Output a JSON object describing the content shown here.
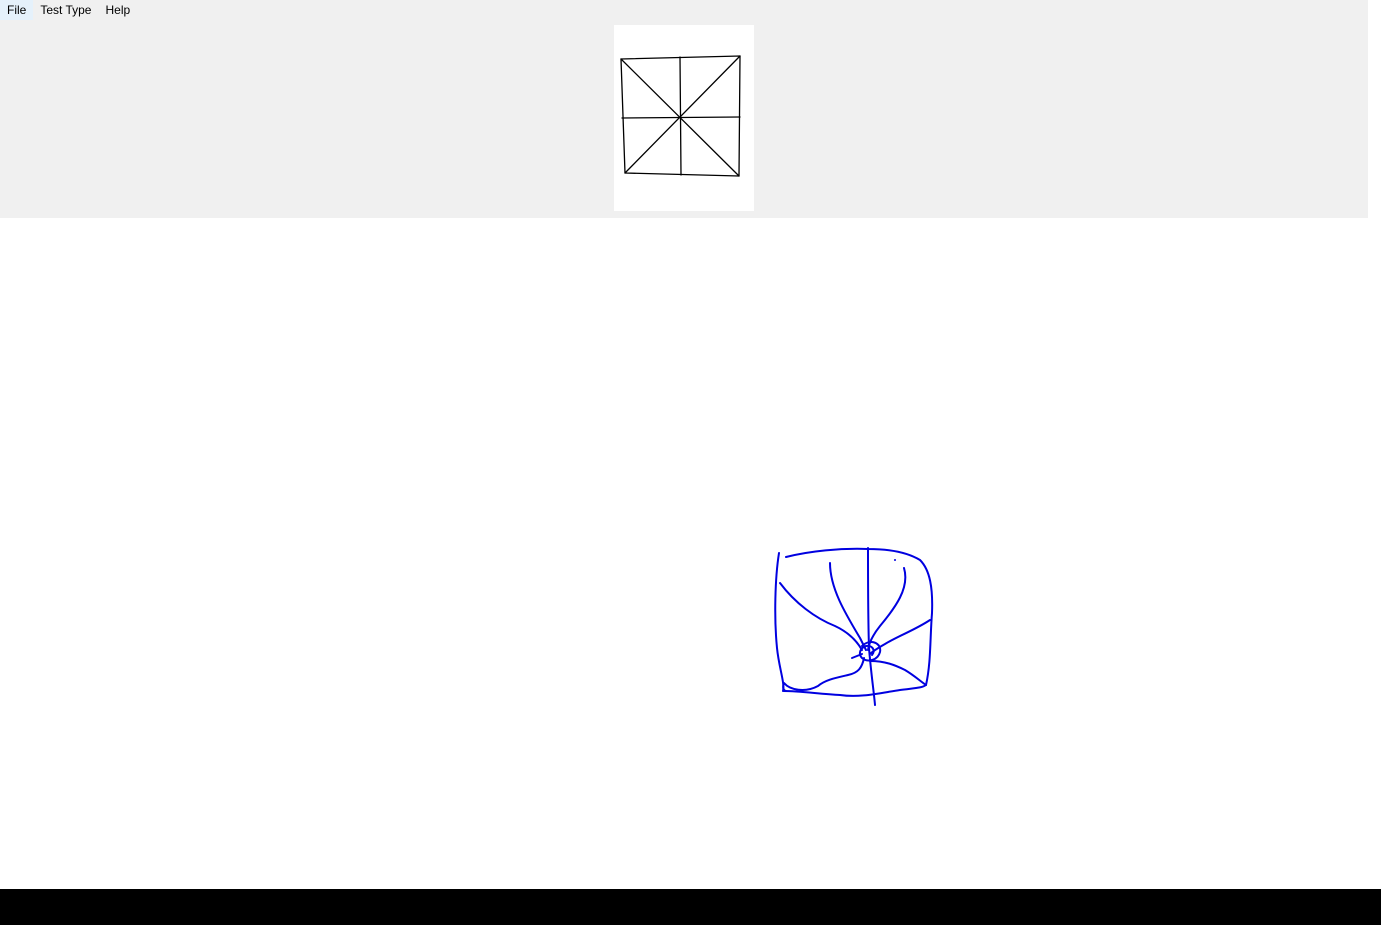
{
  "menu": {
    "items": [
      {
        "label": "File"
      },
      {
        "label": "Test Type"
      },
      {
        "label": "Help"
      }
    ]
  },
  "reference": {
    "figure": "square-with-diagonals-and-midlines",
    "stroke_color": "#000000"
  },
  "canvas": {
    "ink_color": "#0000e0",
    "background": "#ffffff"
  },
  "colors": {
    "chrome": "#f0f0f0",
    "taskbar": "#000000"
  }
}
